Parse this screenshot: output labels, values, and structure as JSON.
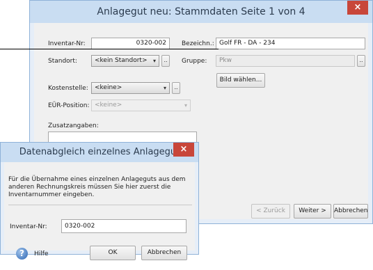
{
  "main_window": {
    "title": "Anlagegut neu: Stammdaten Seite 1 von 4",
    "close": "×",
    "inventar_label": "Inventar-Nr:",
    "inventar_value": "0320-002",
    "bezeichn_label": "Bezeichn.:",
    "bezeichn_value": "Golf FR - DA - 234",
    "standort_label": "Standort:",
    "standort_value": "<kein Standort>",
    "gruppe_label": "Gruppe:",
    "gruppe_value": "Pkw",
    "bild_button": "Bild wählen...",
    "kostenstelle_label": "Kostenstelle:",
    "kostenstelle_value": "<keine>",
    "eur_label": "EÜR-Position:",
    "eur_value": "<keine>",
    "zusatz_label": "Zusatzangaben:",
    "zurueck_button": "< Zurück",
    "weiter_button": "Weiter >",
    "abbrechen_button": "Abbrechen",
    "dots": "..",
    "caret": "▾"
  },
  "dialog": {
    "title": "Datenabgleich einzelnes Anlagegut",
    "close": "×",
    "message_line1": "Für die Übernahme eines einzelnen Anlageguts aus dem",
    "message_line2": "anderen Rechnungskreis müssen Sie hier zuerst die",
    "message_line3": "Inventarnummer eingeben.",
    "inventar_label": "Inventar-Nr:",
    "inventar_value": "0320-002",
    "help_label": "Hilfe",
    "ok_button": "OK",
    "abbrechen_button": "Abbrechen",
    "help_glyph": "?"
  },
  "colors": {
    "titlebar": "#c9ddf2",
    "close": "#c8463a",
    "frame": "#e6eef8",
    "face": "#f0f0f0"
  }
}
